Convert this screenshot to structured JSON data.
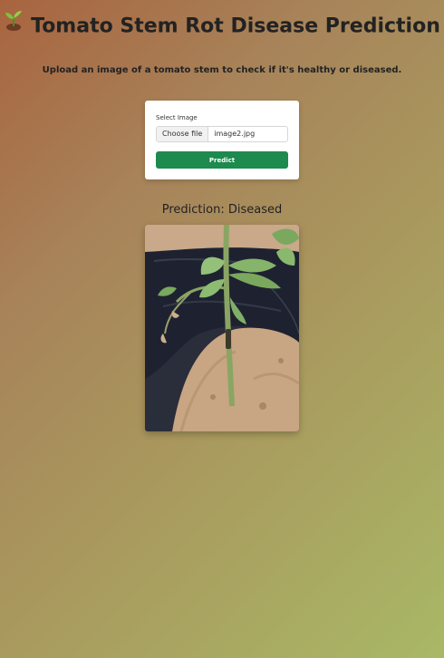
{
  "header": {
    "title": "Tomato Stem Rot Disease Prediction",
    "subtitle": "Upload an image of a tomato stem to check if it's healthy or diseased.",
    "icon": "sprout-icon"
  },
  "form": {
    "label": "Select Image",
    "choose_label": "Choose file",
    "file_name": "image2.jpg",
    "predict_label": "Predict",
    "button_color": "#1d8a4e"
  },
  "result": {
    "prediction_text": "Prediction: Diseased",
    "image_subject": "tomato-stem-photo"
  }
}
